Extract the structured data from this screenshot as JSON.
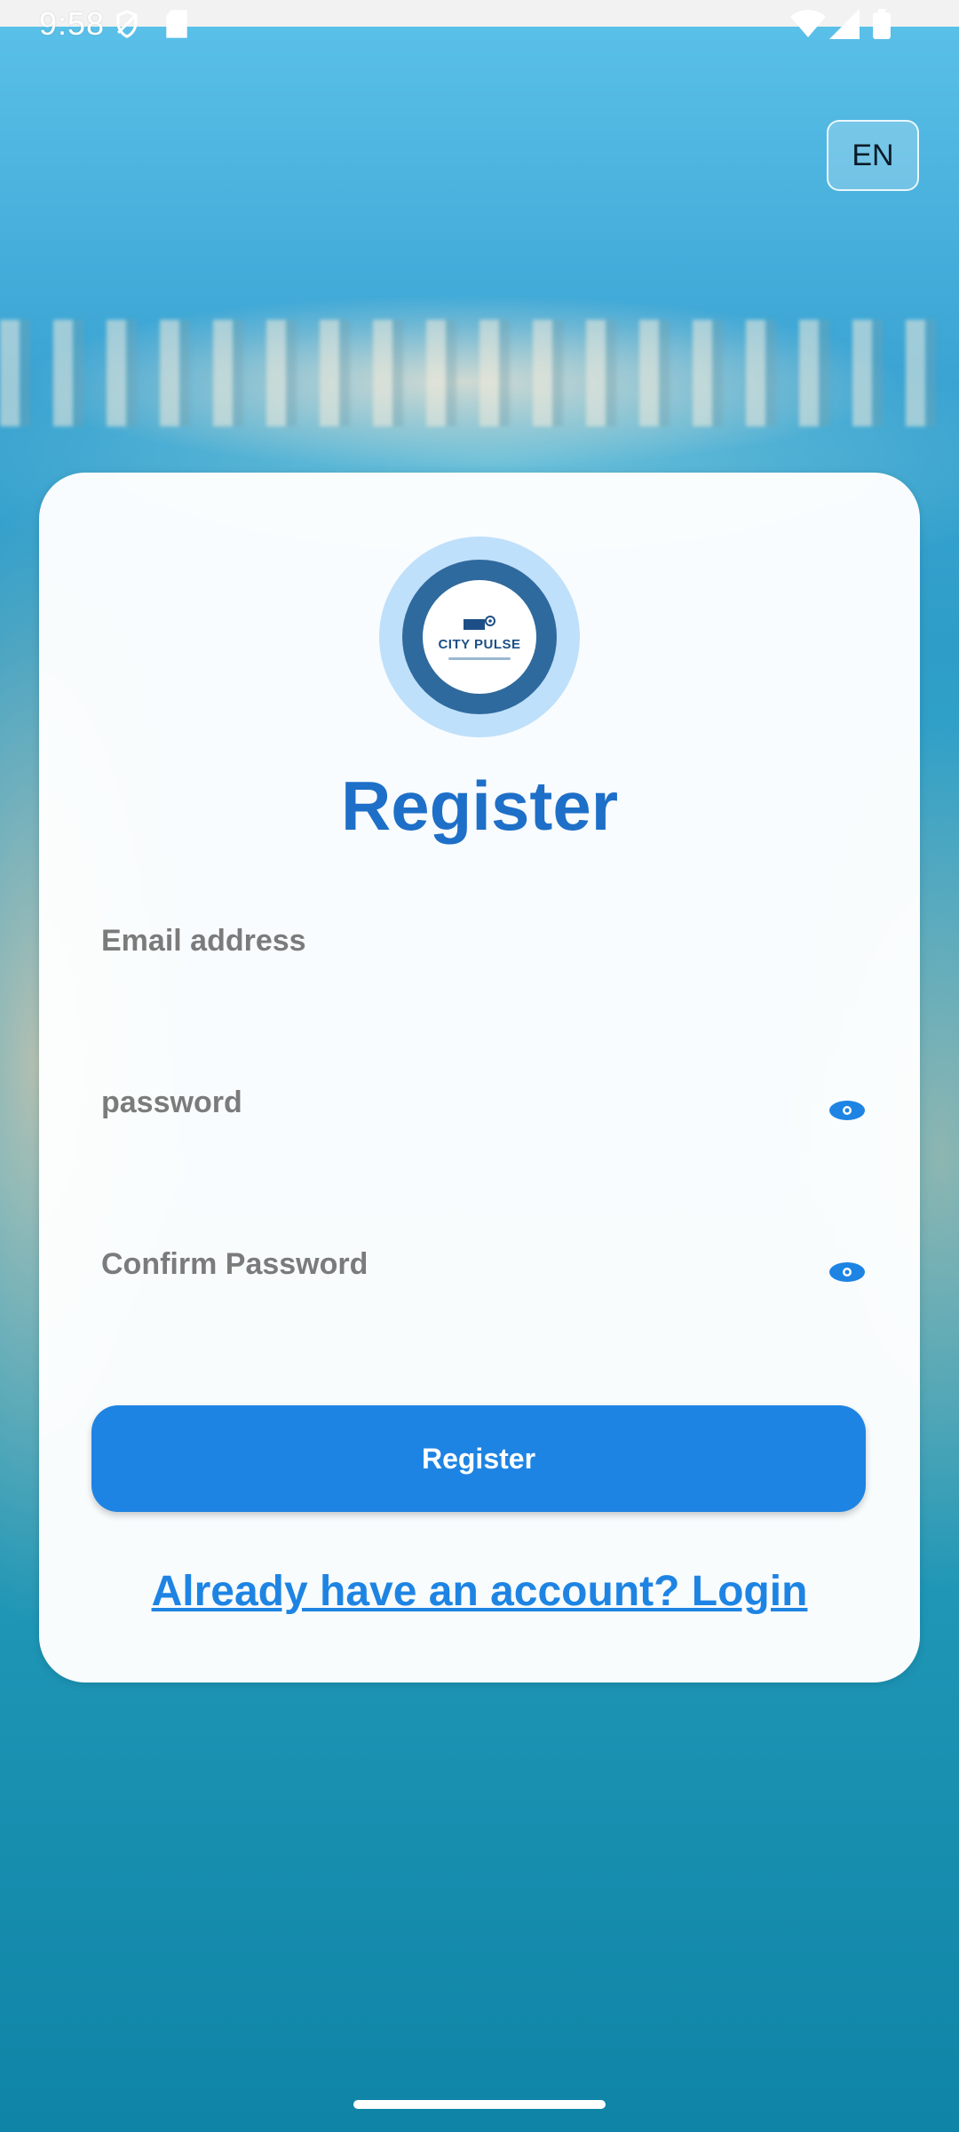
{
  "status_bar": {
    "time": "9:58"
  },
  "language": {
    "label": "EN"
  },
  "logo": {
    "text": "CITY PULSE"
  },
  "form": {
    "title": "Register",
    "email_placeholder": "Email address",
    "password_placeholder": "password",
    "confirm_password_placeholder": "Confirm Password",
    "submit_label": "Register",
    "login_link": "Already have an account? Login"
  },
  "colors": {
    "primary": "#1e84e3",
    "title": "#1e6fc8",
    "logo_ring": "#2f6a9e",
    "logo_halo": "#bfe0fb"
  },
  "icons": {
    "password_toggle": "eye-icon",
    "confirm_password_toggle": "eye-icon"
  }
}
